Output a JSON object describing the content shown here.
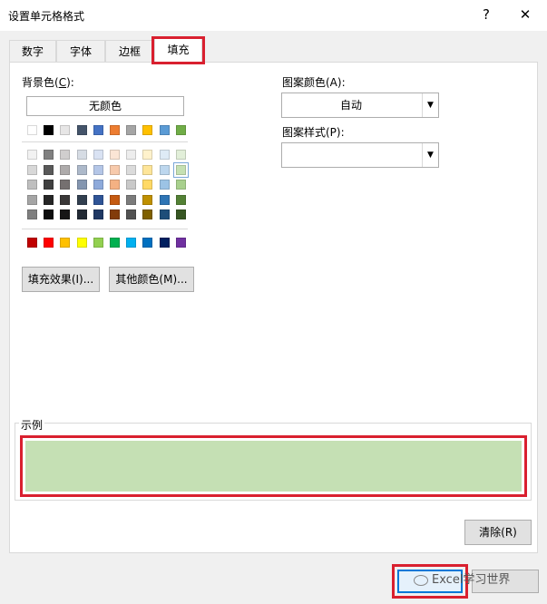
{
  "window": {
    "title": "设置单元格格式",
    "help": "?",
    "close": "✕"
  },
  "tabs": [
    {
      "label": "数字"
    },
    {
      "label": "字体"
    },
    {
      "label": "边框"
    },
    {
      "label": "填充",
      "active": true
    }
  ],
  "background": {
    "label_prefix": "背景色(",
    "hotkey": "C",
    "label_suffix": "):",
    "no_color_label": "无颜色",
    "theme_top": [
      "#ffffff",
      "#000000",
      "#e7e6e6",
      "#44546a",
      "#4472c4",
      "#ed7d31",
      "#a5a5a5",
      "#ffc000",
      "#5b9bd5",
      "#70ad47"
    ],
    "theme_shades": [
      [
        "#f2f2f2",
        "#808080",
        "#d0cece",
        "#d6dce4",
        "#d9e2f3",
        "#fbe5d5",
        "#ededed",
        "#fff2cc",
        "#deebf6",
        "#e2efd9"
      ],
      [
        "#d8d8d8",
        "#595959",
        "#aeabab",
        "#adb9ca",
        "#b4c6e7",
        "#f7caac",
        "#dbdbdb",
        "#fee599",
        "#bdd7ee",
        "#c5e0b3"
      ],
      [
        "#bfbfbf",
        "#404040",
        "#757070",
        "#8496b0",
        "#8eaadb",
        "#f4b183",
        "#c9c9c9",
        "#ffd965",
        "#9cc3e5",
        "#a8d08d"
      ],
      [
        "#a5a5a5",
        "#262626",
        "#3a3838",
        "#323f4f",
        "#2f5496",
        "#c55a11",
        "#7b7b7b",
        "#bf9000",
        "#2e75b5",
        "#538135"
      ],
      [
        "#7f7f7f",
        "#0d0d0d",
        "#171616",
        "#222a35",
        "#1f3864",
        "#833c0b",
        "#525252",
        "#7f6000",
        "#1e4e79",
        "#375623"
      ]
    ],
    "standard": [
      "#c00000",
      "#ff0000",
      "#ffc000",
      "#ffff00",
      "#92d050",
      "#00b050",
      "#00b0f0",
      "#0070c0",
      "#002060",
      "#7030a0"
    ],
    "fill_effects_label": "填充效果(I)...",
    "more_colors_label": "其他颜色(M)..."
  },
  "pattern_color": {
    "label": "图案颜色(A):",
    "value": "自动"
  },
  "pattern_style": {
    "label": "图案样式(P):",
    "value": ""
  },
  "sample": {
    "label": "示例",
    "color": "#c5e0b4"
  },
  "buttons": {
    "clear": "清除(R)"
  },
  "watermark": {
    "text": "Excel学习世界"
  },
  "colors": {
    "highlight": "#d9202f",
    "accent": "#0078d7"
  }
}
